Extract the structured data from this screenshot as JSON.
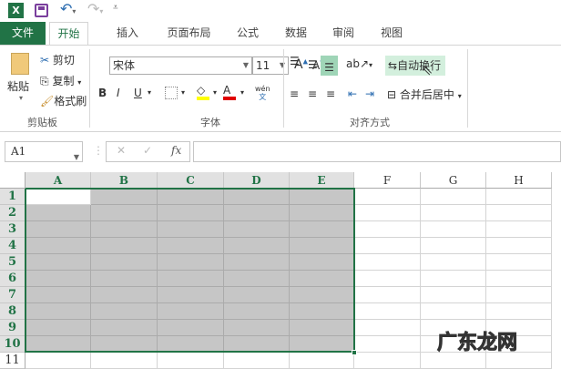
{
  "qat": {
    "app_icon": "excel-icon",
    "save": "save-icon",
    "undo": "undo-icon",
    "redo": "redo-icon",
    "customize": "customize-icon"
  },
  "tabs": [
    "文件",
    "开始",
    "插入",
    "页面布局",
    "公式",
    "数据",
    "审阅",
    "视图"
  ],
  "clipboard": {
    "paste": "粘贴",
    "cut": "剪切",
    "copy": "复制",
    "format_painter": "格式刷",
    "group": "剪贴板"
  },
  "font": {
    "name": "宋体",
    "size": "11",
    "bold": "B",
    "italic": "I",
    "underline": "U",
    "color_letter": "A",
    "phonetic_top": "wén",
    "phonetic_bottom": "文",
    "group": "字体",
    "fill_color": "#ffff00",
    "font_color": "#e00000"
  },
  "alignment": {
    "wrap_text": "自动换行",
    "merge_center": "合并后居中",
    "group": "对齐方式"
  },
  "formula_bar": {
    "name_box": "A1",
    "fx": "fx",
    "cancel": "✕",
    "enter": "✓",
    "value": ""
  },
  "sheet": {
    "columns": [
      "A",
      "B",
      "C",
      "D",
      "E",
      "F",
      "G",
      "H"
    ],
    "rows": [
      "1",
      "2",
      "3",
      "4",
      "5",
      "6",
      "7",
      "8",
      "9",
      "10",
      "11"
    ],
    "selection": "A1:E10",
    "active_cell": "A1"
  },
  "watermark": "广东龙网"
}
